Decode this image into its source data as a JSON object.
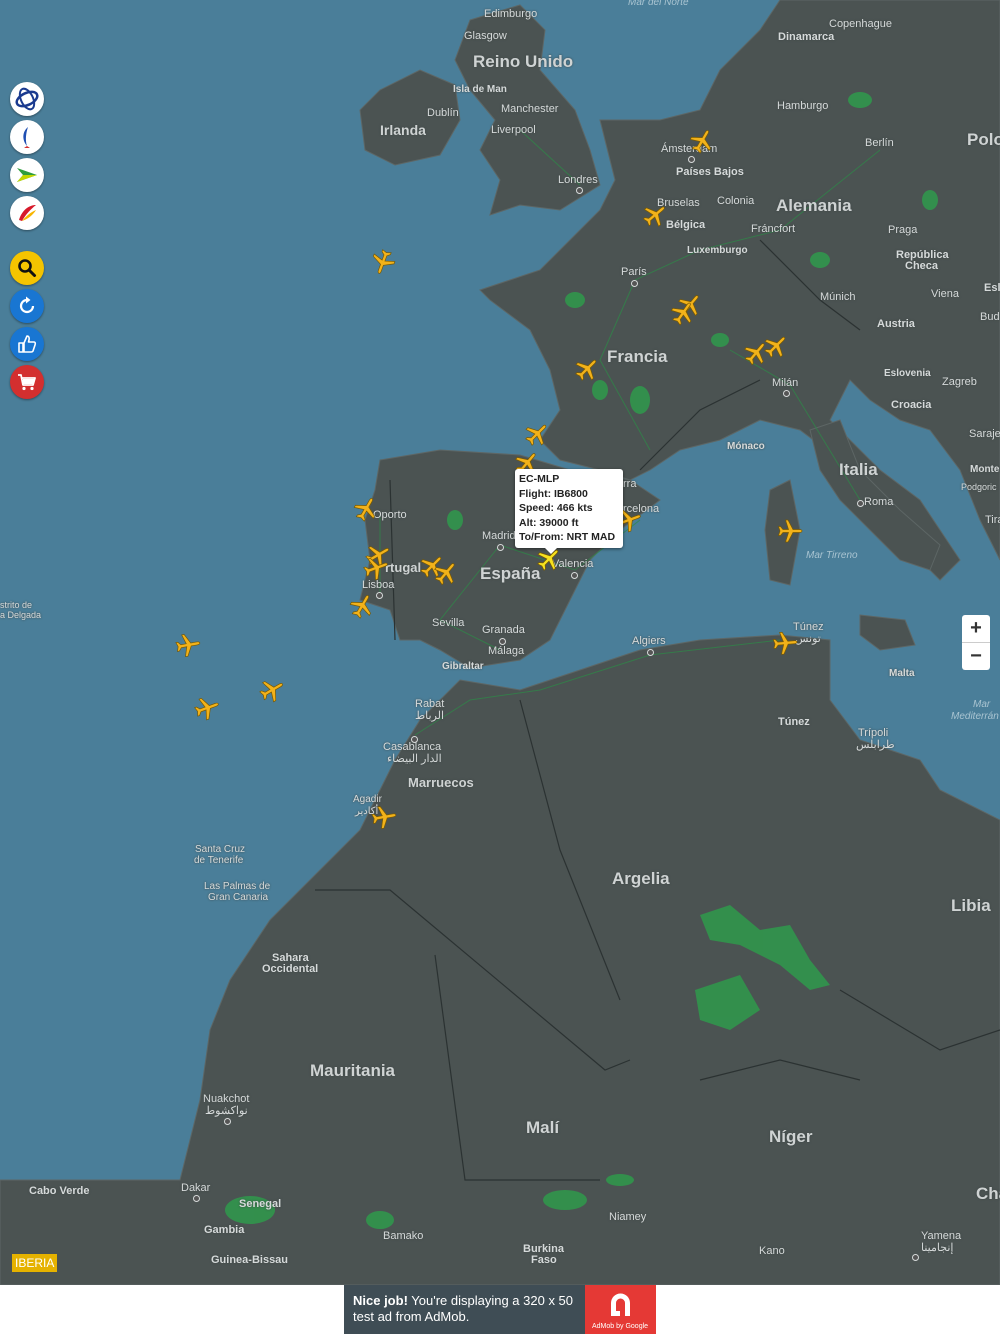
{
  "map": {
    "countries": [
      "Reino Unido",
      "Irlanda",
      "Francia",
      "España",
      "Portugal",
      "Alemania",
      "Italia",
      "Marruecos",
      "Argelia",
      "Libia",
      "Mauritania",
      "Malí",
      "Níger",
      "Senegal",
      "Gambia",
      "Guinea-Bissau",
      "Burkina Faso",
      "Sahara Occidental",
      "Túnez",
      "Bélgica",
      "Países Bajos",
      "Luxemburgo",
      "Dinamarca",
      "Austria",
      "Croacia",
      "Eslovenia",
      "República Checa",
      "Polo",
      "Esl",
      "Bud",
      "Saraje",
      "Monte",
      "Podgoric",
      "Tira",
      "Cha",
      "Mónaco",
      "Malta"
    ],
    "cities": [
      "Edimburgo",
      "Glasgow",
      "Isla de Man",
      "Dublín",
      "Manchester",
      "Liverpool",
      "Londres",
      "Ámsterdam",
      "Bruselas",
      "Colonia",
      "Fráncfort",
      "Hamburgo",
      "Berlín",
      "Copenhague",
      "Praga",
      "Múnich",
      "Viena",
      "Zagreb",
      "París",
      "Milán",
      "Roma",
      "Madrid",
      "Valencia",
      "Barcelona",
      "Oporto",
      "Lisboa",
      "Sevilla",
      "Granada",
      "Málaga",
      "Gibraltar",
      "Rabat",
      "الرباط",
      "Casablanca",
      "الدار البيضاء",
      "Agadir",
      "أكادير",
      "Argel",
      "Túnez",
      "تونس",
      "Trípoli",
      "طرابلس",
      "Santa Cruz de Tenerife",
      "Las Palmas de Gran Canaria",
      "Nuakchot",
      "نواكشوط",
      "Dakar",
      "Bamako",
      "Niamey",
      "Kano",
      "Yamena",
      "إنجامينا",
      "Cabo Verde",
      "Distrito de Ponta Delgada"
    ],
    "seas": [
      "Mar del Norte",
      "Mar Tirreno",
      "Mar Mediterráneo"
    ]
  },
  "labels": {
    "edimburgo": "Edimburgo",
    "glasgow": "Glasgow",
    "reino_unido": "Reino Unido",
    "isla_man": "Isla de Man",
    "dublin": "Dublín",
    "irlanda": "Irlanda",
    "manchester": "Manchester",
    "liverpool": "Liverpool",
    "londres": "Londres",
    "mar_norte": "Mar del Norte",
    "dinamarca": "Dinamarca",
    "copenhague": "Copenhague",
    "hamburgo": "Hamburgo",
    "berlin": "Berlín",
    "polo": "Polo",
    "amsterdam": "Ámsterdam",
    "paises_bajos": "Países Bajos",
    "bruselas": "Bruselas",
    "colonia": "Colonia",
    "belgica": "Bélgica",
    "alemania": "Alemania",
    "francfort": "Fráncfort",
    "luxemburgo": "Luxemburgo",
    "praga": "Praga",
    "rep_checa1": "República",
    "rep_checa2": "Checa",
    "esl": "Esl",
    "paris": "París",
    "munich": "Múnich",
    "viena": "Viena",
    "bud": "Bud",
    "austria": "Austria",
    "francia": "Francia",
    "eslovenia": "Eslovenia",
    "zagreb": "Zagreb",
    "milan": "Milán",
    "croacia": "Croacia",
    "saraje": "Saraje",
    "monaco": "Mónaco",
    "italia": "Italia",
    "monte": "Monte",
    "podgoric": "Podgoric",
    "roma": "Roma",
    "tira": "Tira",
    "barcelona": "rcelona",
    "rra": "rra",
    "madrid": "Madrid",
    "oporto": "Oporto",
    "portugal": "rtugal",
    "espana": "España",
    "valencia": "Valencia",
    "lisboa": "Lisboa",
    "mar_tirreno": "Mar Tirreno",
    "sevilla": "Sevilla",
    "granada": "Granada",
    "malaga": "Málaga",
    "gibraltar": "Gibraltar",
    "tunez_city": "Túnez",
    "tunez_ar": "تونس",
    "argel": "Algiers",
    "malta": "Malta",
    "mar_med1": "Mar",
    "mar_med2": "Mediterrán",
    "tunez": "Túnez",
    "tripoli": "Trípoli",
    "tripoli_ar": "طرابلس",
    "rabat": "Rabat",
    "rabat_ar": "الرباط",
    "casablanca": "Casablanca",
    "casablanca_ar": "الدار البيضاء",
    "marruecos": "Marruecos",
    "agadir": "Agadir",
    "agadir_ar": "أكادير",
    "ponta1": "strito de",
    "ponta2": "a Delgada",
    "tenerife1": "Santa Cruz",
    "tenerife2": "de Tenerife",
    "palmas1": "Las Palmas de",
    "palmas2": "Gran Canaria",
    "argelia": "Argelia",
    "libia": "Libia",
    "sahara1": "Sahara",
    "sahara2": "Occidental",
    "mauritania": "Mauritania",
    "nuakchot": "Nuakchot",
    "nuakchot_ar": "نواكشوط",
    "mali": "Malí",
    "niger": "Níger",
    "cabo_verde": "Cabo Verde",
    "dakar": "Dakar",
    "senegal": "Senegal",
    "cha": "Cha",
    "gambia": "Gambia",
    "bamako": "Bamako",
    "niamey": "Niamey",
    "burkina1": "Burkina",
    "burkina2": "Faso",
    "kano": "Kano",
    "yamena": "Yamena",
    "yamena_ar": "إنجامينا",
    "guinea": "Guinea-Bissau"
  },
  "sidebar": {
    "items": [
      {
        "name": "Air Europa",
        "icon": "air-europa-logo-icon",
        "color": "#ffffff"
      },
      {
        "name": "Air Nostrum",
        "icon": "air-nostrum-logo-icon",
        "color": "#ffffff"
      },
      {
        "name": "Air Europa Express",
        "icon": "airline-arrow-logo-icon",
        "color": "#ffffff"
      },
      {
        "name": "Iberia",
        "icon": "iberia-logo-icon",
        "color": "#ffffff"
      },
      {
        "name": "Search",
        "icon": "search-icon",
        "color": "#f5c400"
      },
      {
        "name": "Refresh",
        "icon": "refresh-icon",
        "color": "#1976d2"
      },
      {
        "name": "Like",
        "icon": "thumbs-up-icon",
        "color": "#1976d2"
      },
      {
        "name": "Shop",
        "icon": "cart-icon",
        "color": "#d32f2f"
      }
    ]
  },
  "popup": {
    "registration": "EC-MLP",
    "flight": "Flight: IB6800",
    "speed": "Speed: 466 kts",
    "altitude": "Alt: 39000 ft",
    "route": "To/From: NRT MAD"
  },
  "zoom": {
    "in": "+",
    "out": "−"
  },
  "brand": {
    "label": "IBERIA",
    "color": "#e5b200"
  },
  "ad": {
    "bold": "Nice job!",
    "text": " You're displaying a 320 x 50 test ad from AdMob.",
    "logo_caption": "AdMob by Google"
  },
  "colors": {
    "sea": "#4a7e99",
    "land": "#4b5352",
    "forest": "#2f9a4c",
    "plane": "#f2b21a",
    "selected_plane": "#f7e21f"
  },
  "flights_count": 25
}
